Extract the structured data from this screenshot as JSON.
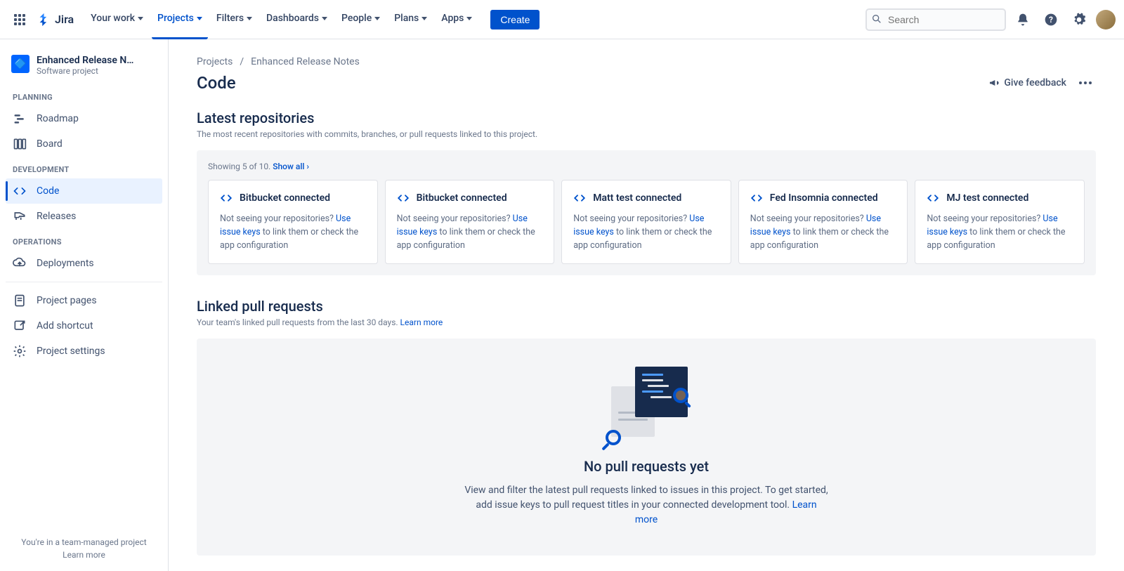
{
  "topnav": {
    "product": "Jira",
    "items": [
      "Your work",
      "Projects",
      "Filters",
      "Dashboards",
      "People",
      "Plans",
      "Apps"
    ],
    "active_index": 1,
    "create": "Create",
    "search_placeholder": "Search"
  },
  "sidebar": {
    "project_name": "Enhanced Release N…",
    "project_type": "Software project",
    "sections": {
      "planning": {
        "label": "PLANNING",
        "items": [
          "Roadmap",
          "Board"
        ]
      },
      "development": {
        "label": "DEVELOPMENT",
        "items": [
          "Code",
          "Releases"
        ],
        "active_index": 0
      },
      "operations": {
        "label": "OPERATIONS",
        "items": [
          "Deployments"
        ]
      }
    },
    "extra": [
      "Project pages",
      "Add shortcut",
      "Project settings"
    ],
    "footer": {
      "line1": "You're in a team-managed project",
      "learn": "Learn more"
    }
  },
  "breadcrumbs": [
    "Projects",
    "Enhanced Release Notes"
  ],
  "page": {
    "title": "Code",
    "feedback": "Give feedback"
  },
  "repos": {
    "title": "Latest repositories",
    "desc": "The most recent repositories with commits, branches, or pull requests linked to this project.",
    "showing": "Showing 5 of 10.",
    "show_all": "Show all",
    "cards": [
      {
        "title": "Bitbucket connected"
      },
      {
        "title": "Bitbucket connected"
      },
      {
        "title": "Matt test connected"
      },
      {
        "title": "Fed Insomnia connected"
      },
      {
        "title": "MJ test connected"
      }
    ],
    "card_text": {
      "prefix": "Not seeing your repositories? ",
      "link": "Use issue keys",
      "suffix": " to link them or check the app configuration"
    }
  },
  "prs": {
    "title": "Linked pull requests",
    "desc": "Your team's linked pull requests from the last 30 days.",
    "learn": "Learn more",
    "empty_title": "No pull requests yet",
    "empty_desc": "View and filter the latest pull requests linked to issues in this project. To get started, add issue keys to pull request titles in your connected development tool.",
    "empty_learn": "Learn more"
  }
}
